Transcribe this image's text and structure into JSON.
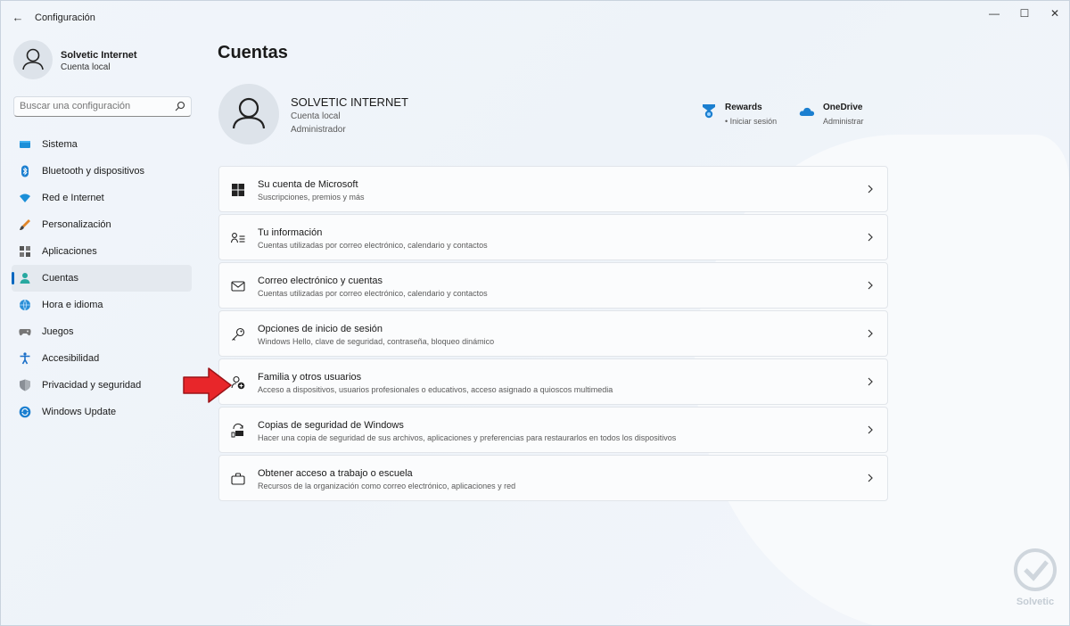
{
  "window": {
    "title": "Configuración",
    "back_glyph": "←",
    "minimize_glyph": "—",
    "maximize_glyph": "☐",
    "close_glyph": "✕"
  },
  "profile": {
    "name": "Solvetic Internet",
    "type": "Cuenta local"
  },
  "search": {
    "placeholder": "Buscar una configuración",
    "icon": "search-icon"
  },
  "sidebar": {
    "items": [
      {
        "label": "Sistema",
        "icon": "monitor-icon"
      },
      {
        "label": "Bluetooth y dispositivos",
        "icon": "bluetooth-icon"
      },
      {
        "label": "Red e Internet",
        "icon": "wifi-icon"
      },
      {
        "label": "Personalización",
        "icon": "brush-icon"
      },
      {
        "label": "Aplicaciones",
        "icon": "apps-icon"
      },
      {
        "label": "Cuentas",
        "icon": "person-icon",
        "active": true
      },
      {
        "label": "Hora e idioma",
        "icon": "globe-clock-icon"
      },
      {
        "label": "Juegos",
        "icon": "gamepad-icon"
      },
      {
        "label": "Accesibilidad",
        "icon": "accessibility-icon"
      },
      {
        "label": "Privacidad y seguridad",
        "icon": "shield-icon"
      },
      {
        "label": "Windows Update",
        "icon": "update-icon"
      }
    ]
  },
  "main": {
    "title": "Cuentas",
    "account": {
      "name": "SOLVETIC INTERNET",
      "type": "Cuenta local",
      "role": "Administrador"
    },
    "services": [
      {
        "title": "Rewards",
        "subtitle": "• Iniciar sesión",
        "icon": "rewards-trophy-icon"
      },
      {
        "title": "OneDrive",
        "subtitle": "Administrar",
        "icon": "onedrive-cloud-icon"
      }
    ],
    "cards": [
      {
        "title": "Su cuenta de Microsoft",
        "subtitle": "Suscripciones, premios y más",
        "icon": "windows-logo-icon"
      },
      {
        "title": "Tu información",
        "subtitle": "Cuentas utilizadas por correo electrónico, calendario y contactos",
        "icon": "person-card-icon"
      },
      {
        "title": "Correo electrónico y cuentas",
        "subtitle": "Cuentas utilizadas por correo electrónico, calendario y contactos",
        "icon": "mail-icon"
      },
      {
        "title": "Opciones de inicio de sesión",
        "subtitle": "Windows Hello, clave de seguridad, contraseña, bloqueo dinámico",
        "icon": "key-icon"
      },
      {
        "title": "Familia y otros usuarios",
        "subtitle": "Acceso a dispositivos, usuarios profesionales o educativos, acceso asignado a quioscos multimedia",
        "icon": "person-add-icon"
      },
      {
        "title": "Copias de seguridad de Windows",
        "subtitle": "Hacer una copia de seguridad de sus archivos, aplicaciones y preferencias para restaurarlos en todos los dispositivos",
        "icon": "backup-sync-icon"
      },
      {
        "title": "Obtener acceso a trabajo o escuela",
        "subtitle": "Recursos de la organización como correo electrónico, aplicaciones y red",
        "icon": "briefcase-icon"
      }
    ]
  },
  "annotation": {
    "arrow_color": "#e8262a",
    "points_to": "Familia y otros usuarios"
  },
  "watermark": {
    "text": "Solvetic"
  },
  "colors": {
    "accent": "#0067c0",
    "background": "#eef3f9",
    "card": "#fbfcfd"
  }
}
